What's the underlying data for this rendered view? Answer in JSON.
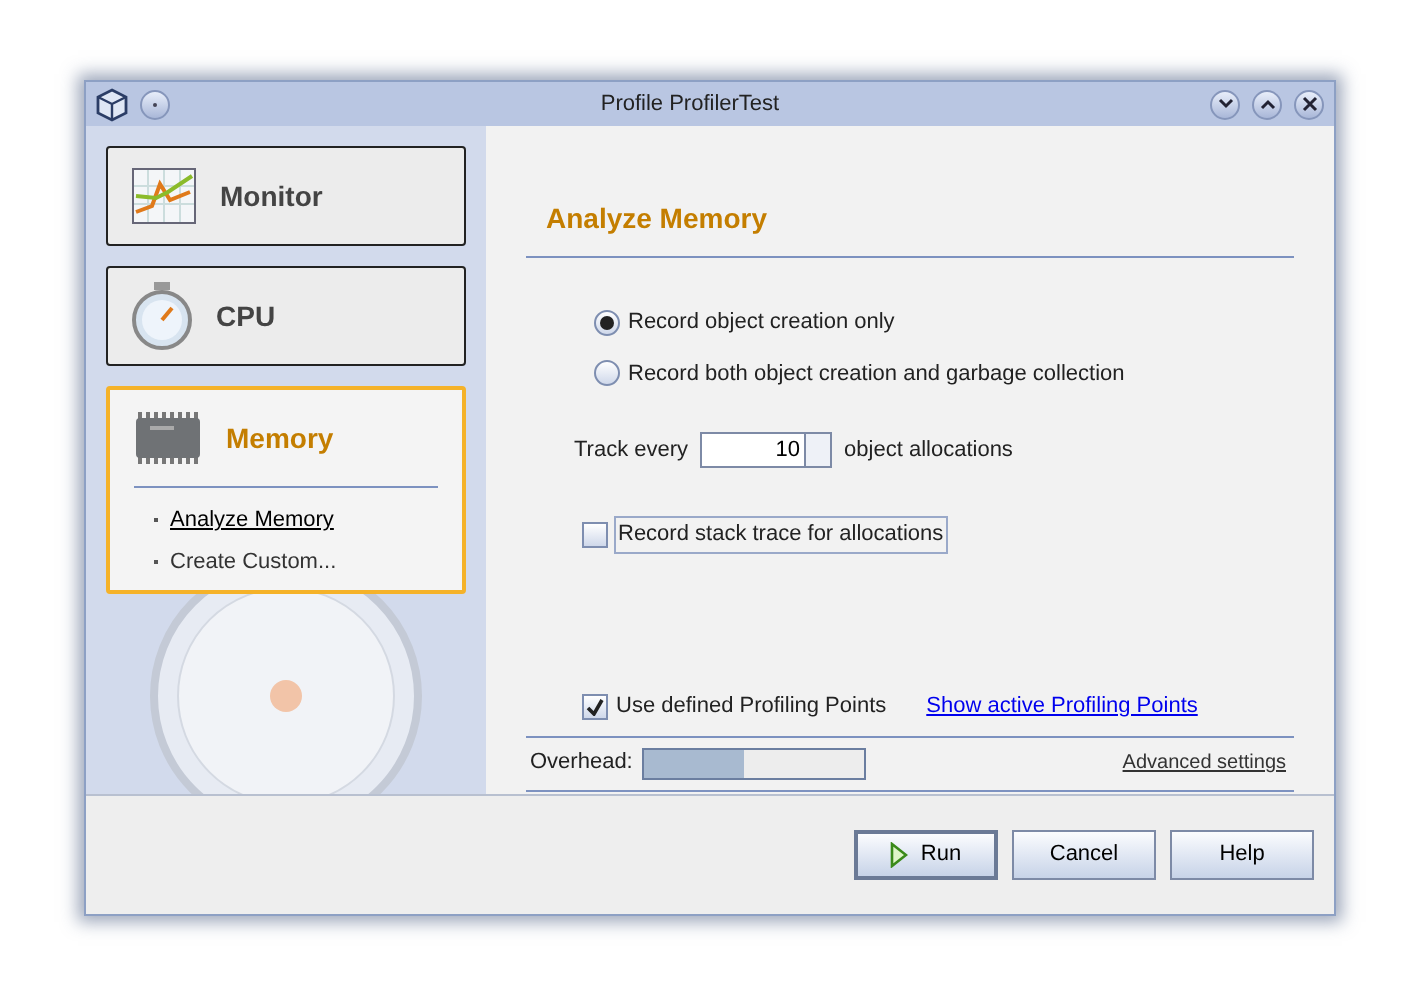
{
  "window": {
    "title": "Profile ProfilerTest"
  },
  "categories": [
    {
      "kind": "monitor",
      "label": "Monitor",
      "selected": false
    },
    {
      "kind": "cpu",
      "label": "CPU",
      "selected": false
    },
    {
      "kind": "memory",
      "label": "Memory",
      "selected": true,
      "items": [
        {
          "label": "Analyze Memory",
          "selected": true
        },
        {
          "label": "Create Custom...",
          "selected": false
        }
      ]
    }
  ],
  "heading": "Analyze Memory",
  "record_options": [
    {
      "label": "Record object creation only",
      "selected": true
    },
    {
      "label": "Record both object creation and garbage collection",
      "selected": false
    }
  ],
  "track": {
    "prefix": "Track every",
    "value": "10",
    "suffix": "object allocations"
  },
  "stack_trace": {
    "label": "Record stack trace for allocations",
    "checked": false
  },
  "profiling_points": {
    "label": "Use defined Profiling Points",
    "checked": true,
    "link": "Show active Profiling Points"
  },
  "overhead": {
    "label": "Overhead:",
    "level": 0.45
  },
  "advanced": "Advanced settings",
  "buttons": [
    {
      "kind": "run",
      "label": "Run"
    },
    {
      "kind": "plain",
      "label": "Cancel"
    },
    {
      "kind": "plain",
      "label": "Help"
    }
  ]
}
